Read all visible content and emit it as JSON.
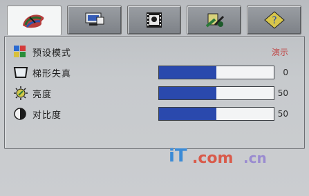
{
  "tabs": [
    {
      "name": "picture-tab",
      "icon": "color-palette-icon",
      "active": true
    },
    {
      "name": "display-tab",
      "icon": "monitor-settings-icon",
      "active": false
    },
    {
      "name": "video-tab",
      "icon": "film-strip-icon",
      "active": false
    },
    {
      "name": "setup-tab",
      "icon": "tools-icon",
      "active": false
    },
    {
      "name": "help-tab",
      "icon": "question-diamond-icon",
      "active": false
    }
  ],
  "menu": {
    "preset_mode": {
      "label": "预设模式",
      "value": "演示"
    },
    "keystone": {
      "label": "梯形失真",
      "value": "0",
      "level": 0.5
    },
    "brightness": {
      "label": "亮度",
      "value": "50",
      "level": 0.5
    },
    "contrast": {
      "label": "对比度",
      "value": "50",
      "level": 0.5
    }
  },
  "watermark": {
    "text": "iT.com.cn"
  },
  "colors": {
    "accent": "#2a49ad",
    "value_red": "#c04b4b"
  }
}
